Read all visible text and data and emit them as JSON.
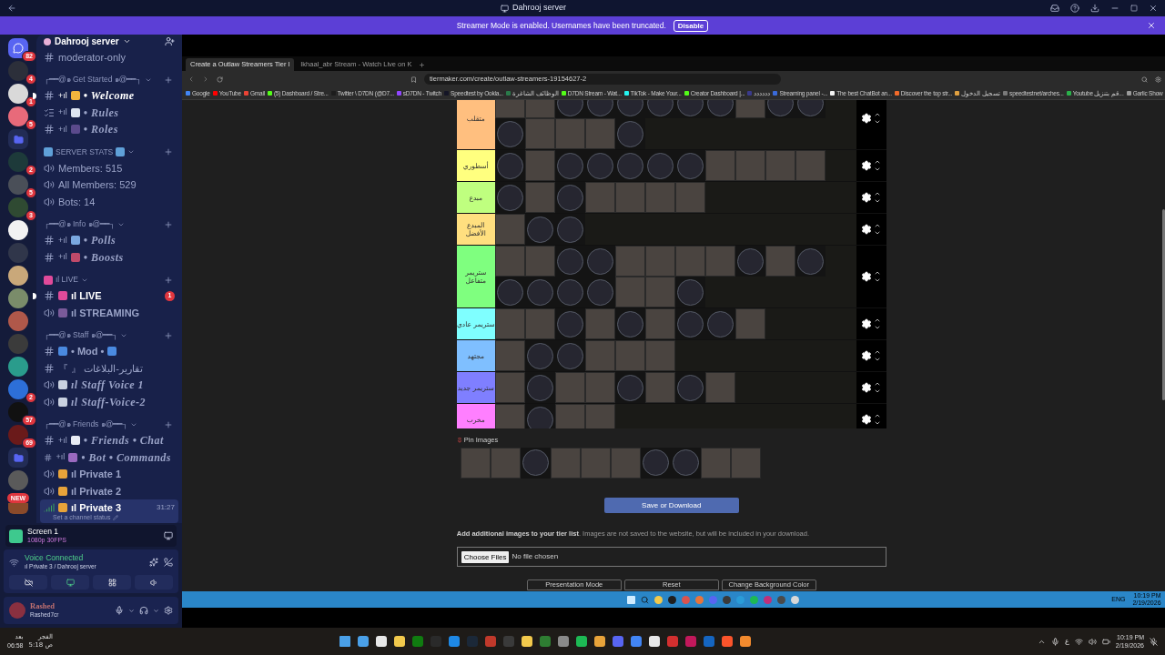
{
  "titlebar": {
    "title": "Dahrooj server"
  },
  "banner": {
    "text": "Streamer Mode is enabled. Usernames have been truncated.",
    "button": "Disable"
  },
  "servers": [
    {
      "kind": "home",
      "color": "#5865f2",
      "badge": "82"
    },
    {
      "kind": "avatar",
      "color": "#2c2f3a",
      "badge": "4"
    },
    {
      "kind": "avatar",
      "color": "#d9d9d9",
      "badge": "1"
    },
    {
      "kind": "avatar",
      "color": "#e86a7a",
      "badge": "5"
    },
    {
      "kind": "folder",
      "color": "#5865f2"
    },
    {
      "kind": "avatar",
      "color": "#1d3a3a",
      "badge": "2"
    },
    {
      "kind": "avatar",
      "color": "#4a4f58",
      "badge": "5"
    },
    {
      "kind": "avatar",
      "color": "#2f4a32",
      "badge": "3"
    },
    {
      "kind": "avatar",
      "color": "#f2f2f2"
    },
    {
      "kind": "avatar",
      "color": "#30364a"
    },
    {
      "kind": "avatar",
      "color": "#c9a87a"
    },
    {
      "kind": "avatar",
      "color": "#7a8c6a"
    },
    {
      "kind": "avatar",
      "color": "#b0584a"
    },
    {
      "kind": "avatar",
      "color": "#3b3b3b"
    },
    {
      "kind": "avatar",
      "color": "#2a9c8c"
    },
    {
      "kind": "avatar",
      "color": "#2d6fd8",
      "badge": "2"
    },
    {
      "kind": "avatar",
      "color": "#111111",
      "badge": "57"
    },
    {
      "kind": "avatar",
      "color": "#6a1a1a",
      "badge": "69"
    },
    {
      "kind": "folder",
      "color": "#5865f2"
    },
    {
      "kind": "avatar",
      "color": "#5a5a5a"
    },
    {
      "kind": "new",
      "color": "#8a4a2a",
      "badge": "NEW"
    }
  ],
  "server_header": {
    "name": "Dahrooj server"
  },
  "channels": [
    {
      "kind": "text",
      "label": "moderator-only",
      "selected": false,
      "unread": false
    },
    {
      "kind": "category",
      "label": "┌━━@๑ Get Started ๑@━━┐"
    },
    {
      "kind": "fancytext",
      "prefix": "+ıl",
      "lead": {
        "color": "#f2b33d"
      },
      "label": "• Welcome",
      "selected": false,
      "unread": true
    },
    {
      "kind": "fancyrules",
      "prefix": "+ıl",
      "lead": {
        "color": "#dfe6f2"
      },
      "label": "• Rules",
      "selected": false,
      "unread": false
    },
    {
      "kind": "fancytext",
      "prefix": "+ıl",
      "lead": {
        "color": "#5b4a8c"
      },
      "label": "• Roles",
      "selected": false,
      "unread": false
    },
    {
      "kind": "category",
      "lead": {
        "color": "#5fa0d8"
      },
      "trail": {
        "color": "#5fa0d8"
      },
      "label": "SERVER STATS"
    },
    {
      "kind": "voice",
      "label": "Members: 515",
      "selected": false,
      "unread": false
    },
    {
      "kind": "voice",
      "label": "All Members: 529",
      "selected": false,
      "unread": false
    },
    {
      "kind": "voice",
      "label": "Bots: 14",
      "selected": false,
      "unread": false
    },
    {
      "kind": "category",
      "label": "┌━━@๑ Info ๑@━━┐"
    },
    {
      "kind": "fancytext",
      "prefix": "+ıl",
      "lead": {
        "color": "#7aa8e0"
      },
      "label": "• Polls",
      "selected": false,
      "unread": false
    },
    {
      "kind": "fancytext",
      "prefix": "+ıl",
      "lead": {
        "color": "#c04a6a"
      },
      "label": "• Boosts",
      "selected": false,
      "unread": false
    },
    {
      "kind": "category",
      "lead": {
        "color": "#e04a9a"
      },
      "label": "ıl LIVE"
    },
    {
      "kind": "boldtext",
      "lead": {
        "color": "#e04a9a"
      },
      "label": "ıl LIVE",
      "selected": false,
      "unread": true,
      "badge": "1"
    },
    {
      "kind": "boldvoice",
      "lead": {
        "color": "#7a5a9a"
      },
      "label": "ıl STREAMING",
      "selected": false,
      "unread": false
    },
    {
      "kind": "category",
      "label": "┌━━@๑ Staff ๑@━━┐"
    },
    {
      "kind": "boldtext",
      "lead": {
        "color": "#4a8ae0"
      },
      "trail": {
        "color": "#4a8ae0"
      },
      "label": "• Mod •",
      "selected": false,
      "unread": false
    },
    {
      "kind": "text",
      "label": "『 』 تقارير-البلاغات",
      "selected": false,
      "unread": false
    },
    {
      "kind": "fancyvoice",
      "lead": {
        "color": "#c9d1e0"
      },
      "label": "ıl Staff Voice 1",
      "selected": false,
      "unread": false
    },
    {
      "kind": "fancyvoice",
      "lead": {
        "color": "#c9d1e0"
      },
      "label": "ıl Staff-Voice-2",
      "selected": false,
      "unread": false
    },
    {
      "kind": "category",
      "label": "┌━━@๑ Friends ๑@━━┐"
    },
    {
      "kind": "fancytext",
      "prefix": "+ıl",
      "lead": {
        "color": "#e8ecf5"
      },
      "label": "• Friends • Chat",
      "selected": false,
      "unread": false
    },
    {
      "kind": "fancytext",
      "prefix": "+ıl",
      "lead": {
        "color": "#9a6ac0"
      },
      "label": "• Bot • Commands",
      "selected": false,
      "unread": false
    },
    {
      "kind": "boldvoice",
      "lead": {
        "color": "#e8a33a"
      },
      "label": "ıl Private 1",
      "selected": false,
      "unread": false
    },
    {
      "kind": "boldvoice",
      "lead": {
        "color": "#e8a33a"
      },
      "label": "ıl Private 2",
      "selected": false,
      "unread": false
    },
    {
      "kind": "boldvoice",
      "lead": {
        "color": "#e8a33a"
      },
      "label": "ıl Private 3",
      "selected": true,
      "unread": false,
      "time": "31:27",
      "status": "Set a channel status"
    }
  ],
  "stream_panel": {
    "title": "Screen 1",
    "quality": "1080p 30FPS"
  },
  "voice": {
    "status": "Voice Connected",
    "channel": "ıl Private 3 / Dahrooj server"
  },
  "user": {
    "name": "Rashed",
    "tag": "Rashed7cr"
  },
  "browser": {
    "tabs": [
      {
        "label": "Create a Outlaw Streamers Tier l",
        "selected": true
      },
      {
        "label": "Ikhaal_abr Stream - Watch Live on K",
        "selected": false
      }
    ],
    "url": "tiermaker.com/create/outlaw-streamers-19154627-2",
    "bookmarks": [
      {
        "label": "Google",
        "color": "#4285f4"
      },
      {
        "label": "YouTube",
        "color": "#ff0000"
      },
      {
        "label": "Gmail",
        "color": "#ea4335"
      },
      {
        "label": "(5) Dashboard / Stre...",
        "color": "#53fc18"
      },
      {
        "label": "Twitter \\ D7DN (@D7...",
        "color": "#1d1d1d"
      },
      {
        "label": "sD7DN - Twitch",
        "color": "#9146ff"
      },
      {
        "label": "Speedtest by Ookla...",
        "color": "#141526"
      },
      {
        "label": "الوظائف الشاغرة",
        "color": "#2a7a4a"
      },
      {
        "label": "D7DN Stream - Wat...",
        "color": "#53fc18"
      },
      {
        "label": "TikTok - Make Your...",
        "color": "#25f4ee"
      },
      {
        "label": "Creator Dashboard |...",
        "color": "#53fc18"
      },
      {
        "label": "دددددد",
        "color": "#3a3a8a"
      },
      {
        "label": "Streaming panel -...",
        "color": "#3a6ad8"
      },
      {
        "label": "The best ChatBot an...",
        "color": "#f2f2f2"
      },
      {
        "label": "Discover the top str...",
        "color": "#f26a2a"
      },
      {
        "label": "تسجيل الدخول",
        "color": "#e0a040"
      },
      {
        "label": "speedtestnet/arches...",
        "color": "#7a7a7a"
      },
      {
        "label": "Youtube قم بتنزيل...",
        "color": "#2ab04a"
      },
      {
        "label": "Garlic Show",
        "color": "#9a9a9a"
      }
    ]
  },
  "tierlist": {
    "tiers": [
      {
        "label": "متقلب",
        "color": "#ffbf7f",
        "tiles": [
          {
            "kind": "square"
          },
          {
            "kind": "square"
          },
          {
            "kind": "round"
          },
          {
            "kind": "round"
          },
          {
            "kind": "round"
          },
          {
            "kind": "round"
          },
          {
            "kind": "round"
          },
          {
            "kind": "round"
          },
          {
            "kind": "square"
          },
          {
            "kind": "round"
          },
          {
            "kind": "round"
          },
          {
            "kind": "round"
          },
          {
            "kind": "square"
          },
          {
            "kind": "square"
          },
          {
            "kind": "square"
          },
          {
            "kind": "round"
          }
        ]
      },
      {
        "label": "أسطوري",
        "color": "#ffff7f",
        "tiles": [
          {
            "kind": "round"
          },
          {
            "kind": "square"
          },
          {
            "kind": "round"
          },
          {
            "kind": "round"
          },
          {
            "kind": "round"
          },
          {
            "kind": "round"
          },
          {
            "kind": "round"
          },
          {
            "kind": "square"
          },
          {
            "kind": "square"
          },
          {
            "kind": "square"
          },
          {
            "kind": "square"
          }
        ]
      },
      {
        "label": "مبدع",
        "color": "#bfff7f",
        "tiles": [
          {
            "kind": "round"
          },
          {
            "kind": "square"
          },
          {
            "kind": "round"
          },
          {
            "kind": "square"
          },
          {
            "kind": "square"
          },
          {
            "kind": "square"
          },
          {
            "kind": "square"
          }
        ]
      },
      {
        "label": "المبدع الأفضل",
        "color": "#ffdf7f",
        "tiles": [
          {
            "kind": "square"
          },
          {
            "kind": "round"
          },
          {
            "kind": "round"
          }
        ]
      },
      {
        "label": "ستريمر متفاعل",
        "color": "#7fff7f",
        "tiles": [
          {
            "kind": "square"
          },
          {
            "kind": "square"
          },
          {
            "kind": "round"
          },
          {
            "kind": "round"
          },
          {
            "kind": "square"
          },
          {
            "kind": "square"
          },
          {
            "kind": "square"
          },
          {
            "kind": "square"
          },
          {
            "kind": "round"
          },
          {
            "kind": "square"
          },
          {
            "kind": "round"
          },
          {
            "kind": "round"
          },
          {
            "kind": "round"
          },
          {
            "kind": "round"
          },
          {
            "kind": "round"
          },
          {
            "kind": "square"
          },
          {
            "kind": "square"
          },
          {
            "kind": "round"
          }
        ]
      },
      {
        "label": "ستريمر عادي",
        "color": "#7fffff",
        "tiles": [
          {
            "kind": "square"
          },
          {
            "kind": "square"
          },
          {
            "kind": "round"
          },
          {
            "kind": "square"
          },
          {
            "kind": "round"
          },
          {
            "kind": "square"
          },
          {
            "kind": "round"
          },
          {
            "kind": "round"
          },
          {
            "kind": "square"
          }
        ]
      },
      {
        "label": "مجتهد",
        "color": "#7fbfff",
        "tiles": [
          {
            "kind": "square"
          },
          {
            "kind": "round"
          },
          {
            "kind": "round"
          },
          {
            "kind": "square"
          },
          {
            "kind": "square"
          },
          {
            "kind": "square"
          }
        ]
      },
      {
        "label": "ستريمر جديد",
        "color": "#7f7fff",
        "tiles": [
          {
            "kind": "square"
          },
          {
            "kind": "round"
          },
          {
            "kind": "square"
          },
          {
            "kind": "square"
          },
          {
            "kind": "round"
          },
          {
            "kind": "square"
          },
          {
            "kind": "round"
          },
          {
            "kind": "square"
          }
        ]
      },
      {
        "label": "مخرب",
        "color": "#ff7fff",
        "tiles": [
          {
            "kind": "square"
          },
          {
            "kind": "round"
          },
          {
            "kind": "square"
          },
          {
            "kind": "square"
          }
        ]
      }
    ]
  },
  "pin_images": {
    "label": "Pin Images",
    "tiles": [
      {
        "kind": "square"
      },
      {
        "kind": "square"
      },
      {
        "kind": "round"
      },
      {
        "kind": "square"
      },
      {
        "kind": "square"
      },
      {
        "kind": "square"
      },
      {
        "kind": "round"
      },
      {
        "kind": "round"
      },
      {
        "kind": "square"
      },
      {
        "kind": "square"
      }
    ]
  },
  "save_button": "Save or Download",
  "upload": {
    "note": "**Add additional images to your tier list**. Images are not saved to the website, but will be included in your download.",
    "button": "Choose Files",
    "status": "No file chosen"
  },
  "actions": [
    "Presentation Mode",
    "Reset",
    "Change Background Color"
  ],
  "inner_taskbar": {
    "apps": [
      {
        "color": "#f2c94c"
      },
      {
        "color": "#1f1f1f"
      },
      {
        "color": "#d9534f"
      },
      {
        "color": "#e8743b"
      },
      {
        "color": "#5865f2"
      },
      {
        "color": "#3a3a3a"
      },
      {
        "color": "#2a9cd8"
      },
      {
        "color": "#1db954"
      },
      {
        "color": "#c0307a"
      },
      {
        "color": "#4a4a4a"
      },
      {
        "color": "#d8d8d8"
      }
    ],
    "lang": "ENG",
    "time": "10:19 PM",
    "date": "2/19/2026"
  },
  "taskbar": {
    "prayer_time": "06:58",
    "prayer_name": "الفجر",
    "prayer_label": "بعد",
    "prayer_next": "5:18 ص",
    "apps": [
      {
        "color": "#4aa0e8"
      },
      {
        "color": "#e8e8e8"
      },
      {
        "color": "#f2c94c"
      },
      {
        "color": "#107c10"
      },
      {
        "color": "#2a2a2a"
      },
      {
        "color": "#1e88e5"
      },
      {
        "color": "#1b2838"
      },
      {
        "color": "#c0392b"
      },
      {
        "color": "#3a3a3a"
      },
      {
        "color": "#f2c94c"
      },
      {
        "color": "#2e7d32"
      },
      {
        "color": "#8a8a8a"
      },
      {
        "color": "#1db954"
      },
      {
        "color": "#e8a33a"
      },
      {
        "color": "#5865f2"
      },
      {
        "color": "#4285f4"
      },
      {
        "color": "#e8e8e8"
      },
      {
        "color": "#d32f2f"
      },
      {
        "color": "#c2185b"
      },
      {
        "color": "#1565c0"
      },
      {
        "color": "#fb542b"
      },
      {
        "color": "#f28a2e"
      }
    ],
    "lang": "ع",
    "time": "10:19 PM",
    "date": "2/19/2026"
  }
}
